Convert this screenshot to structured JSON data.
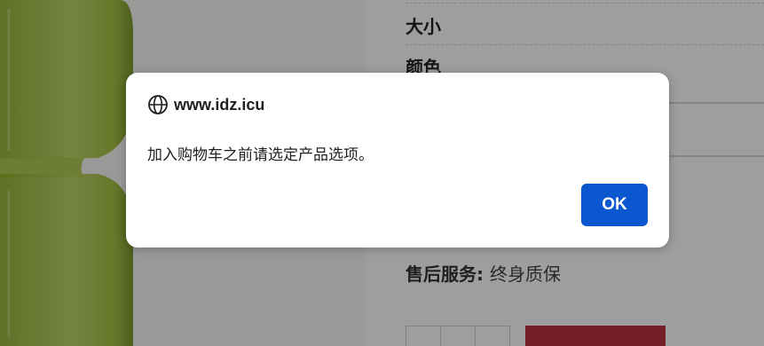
{
  "product": {
    "options": {
      "size_label": "大小",
      "color_label": "颜色"
    },
    "after_sales": {
      "key": "售后服务",
      "value": "终身质保"
    }
  },
  "dialog": {
    "host": "www.idz.icu",
    "message": "加入购物车之前请选定产品选项。",
    "ok_label": "OK"
  },
  "colors": {
    "ok_button": "#0b57d0",
    "add_to_cart": "#b8323f"
  }
}
